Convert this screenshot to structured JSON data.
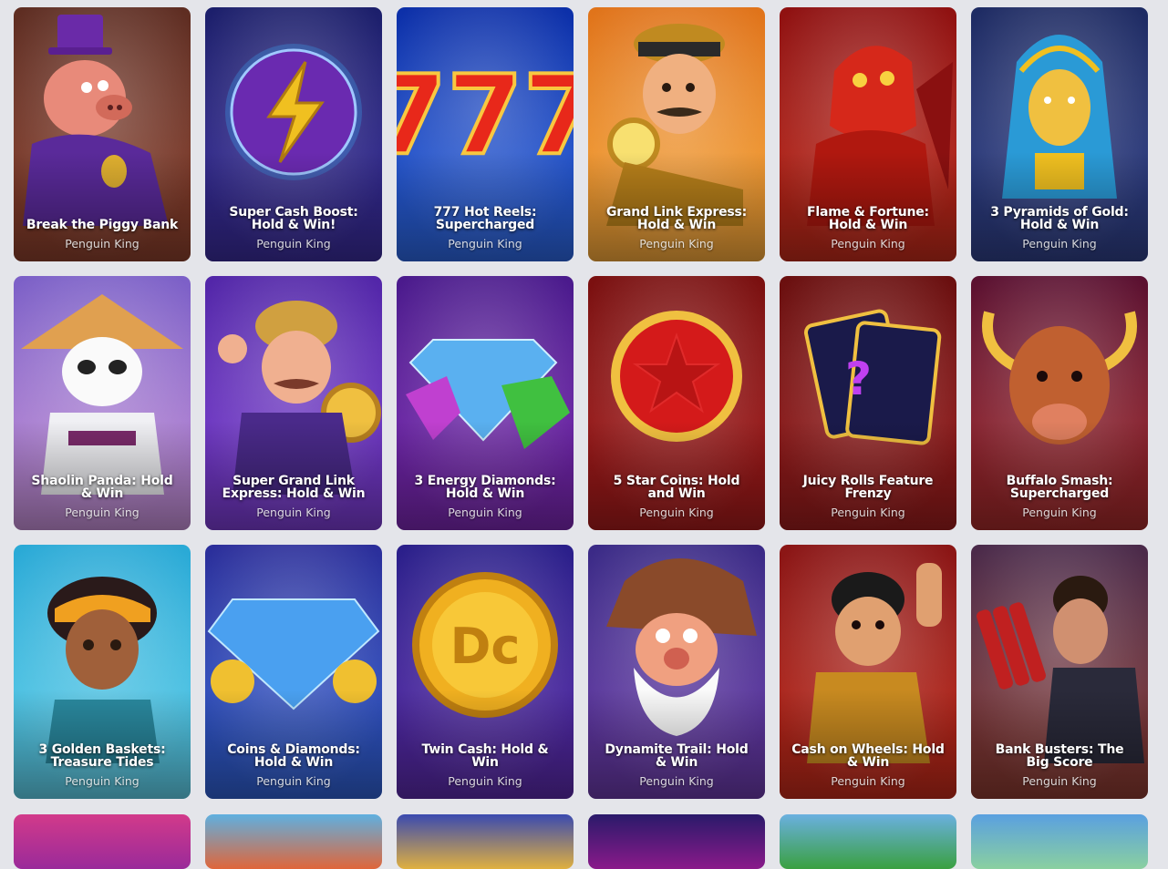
{
  "games": [
    {
      "title": "Break the Piggy Bank",
      "provider": "Penguin King",
      "theme": "piggy",
      "bg": [
        "#5e2d22",
        "#8a3f2c"
      ]
    },
    {
      "title": "Super Cash Boost: Hold & Win!",
      "provider": "Penguin King",
      "theme": "bolt",
      "bg": [
        "#1c1f6b",
        "#3a2c9a"
      ]
    },
    {
      "title": "777 Hot Reels: Supercharged",
      "provider": "Penguin King",
      "theme": "sevens",
      "bg": [
        "#0c2fa8",
        "#2d66e0"
      ]
    },
    {
      "title": "Grand Link Express: Hold & Win",
      "provider": "Penguin King",
      "theme": "conductor",
      "bg": [
        "#e0731a",
        "#f6a83a"
      ]
    },
    {
      "title": "Flame & Fortune: Hold & Win",
      "provider": "Penguin King",
      "theme": "dragon",
      "bg": [
        "#8f1111",
        "#c02a1a"
      ]
    },
    {
      "title": "3 Pyramids of Gold: Hold & Win",
      "provider": "Penguin King",
      "theme": "pharaoh",
      "bg": [
        "#1e2b63",
        "#2f3f86"
      ]
    },
    {
      "title": "Shaolin Panda: Hold & Win",
      "provider": "Penguin King",
      "theme": "panda",
      "bg": [
        "#7b5fc7",
        "#c58fd6"
      ]
    },
    {
      "title": "Super Grand Link Express: Hold & Win",
      "provider": "Penguin King",
      "theme": "captain",
      "bg": [
        "#5226a8",
        "#7a3cd0"
      ]
    },
    {
      "title": "3 Energy Diamonds: Hold & Win",
      "provider": "Penguin King",
      "theme": "diamonds",
      "bg": [
        "#4a1a8c",
        "#7a27b0"
      ]
    },
    {
      "title": "5 Star Coins: Hold and Win",
      "provider": "Penguin King",
      "theme": "starcoin",
      "bg": [
        "#7a1010",
        "#a51b1b"
      ]
    },
    {
      "title": "Juicy Rolls Feature Frenzy",
      "provider": "Penguin King",
      "theme": "cards",
      "bg": [
        "#6a0f0f",
        "#9a1d1d"
      ]
    },
    {
      "title": "Buffalo Smash: Supercharged",
      "provider": "Penguin King",
      "theme": "buffalo",
      "bg": [
        "#5a1030",
        "#a32a2a"
      ]
    },
    {
      "title": "3 Golden Baskets: Treasure Tides",
      "provider": "Penguin King",
      "theme": "girl",
      "bg": [
        "#29a9d6",
        "#5fd0ea"
      ]
    },
    {
      "title": "Coins & Diamonds: Hold & Win",
      "provider": "Penguin King",
      "theme": "diamond",
      "bg": [
        "#2b2e9a",
        "#2f5fd0"
      ]
    },
    {
      "title": "Twin Cash: Hold & Win",
      "provider": "Penguin King",
      "theme": "dccoin",
      "bg": [
        "#2a1f8a",
        "#5a2aa8"
      ]
    },
    {
      "title": "Dynamite Trail: Hold & Win",
      "provider": "Penguin King",
      "theme": "miner",
      "bg": [
        "#3a2a86",
        "#6a3aa8"
      ]
    },
    {
      "title": "Cash on Wheels: Hold & Win",
      "provider": "Penguin King",
      "theme": "driver",
      "bg": [
        "#8a1515",
        "#c02a1a"
      ]
    },
    {
      "title": "Bank Busters: The Big Score",
      "provider": "Penguin King",
      "theme": "robber",
      "bg": [
        "#4a2a4a",
        "#8a3a30"
      ]
    }
  ],
  "partial_row": [
    {
      "bg": [
        "#d23a8a",
        "#9a2a9a"
      ]
    },
    {
      "bg": [
        "#5fb0e0",
        "#e0663a"
      ]
    },
    {
      "bg": [
        "#3a4ab0",
        "#e0b040"
      ]
    },
    {
      "bg": [
        "#2a1a6a",
        "#8a1a8a"
      ]
    },
    {
      "bg": [
        "#6ab0e0",
        "#3aa040"
      ]
    },
    {
      "bg": [
        "#5aa0e0",
        "#8ad0a0"
      ]
    }
  ]
}
